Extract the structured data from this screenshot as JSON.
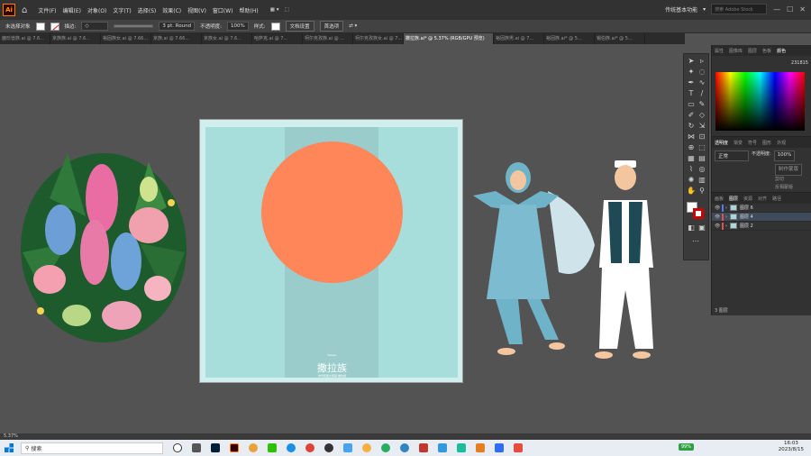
{
  "app": {
    "logo": "Ai",
    "workspace": "传统基本功能",
    "search_placeholder": "搜索 Adobe Stock"
  },
  "menu": [
    "文件(F)",
    "编辑(E)",
    "对象(O)",
    "文字(T)",
    "选择(S)",
    "效果(C)",
    "视图(V)",
    "窗口(W)",
    "帮助(H)"
  ],
  "controlbar": {
    "selection": "未选择对象",
    "stroke_label": "描边:",
    "brush": "3 pt. Round",
    "opacity_label": "不透明度:",
    "opacity": "100%",
    "style_label": "样式:",
    "doc_setup": "文档设置",
    "prefs": "首选项"
  },
  "tabs": [
    "鹿珍兽族.ai @ 7.6...",
    "京族族.ai @ 7.6...",
    "裕固族女.ai @ 7.66...",
    "京族.ai @ 7.66...",
    "京族女.ai @ 7.6...",
    "哈萨克.ai @ 7...",
    "柯尔克孜族.ai @ ...",
    "柯尔克孜族女.ai @ 7...",
    "撒拉族.ai* @ 5.37% (RGB/GPU 预览)",
    "裕固族男.ai @ 7...",
    "裕固族.ai* @ 5...",
    "锡伯族.ai* @ 5..."
  ],
  "color_panel": {
    "tabs": [
      "属性",
      "图像库",
      "图层",
      "色板",
      "颜色"
    ],
    "hex": "231815"
  },
  "transparency_panel": {
    "tabs": [
      "透明度",
      "渐变",
      "符号",
      "图形",
      "外观"
    ],
    "mode": "正常",
    "opacity_label": "不透明度:",
    "opacity": "100%",
    "btn_make_mask": "制作蒙版",
    "chk_clip": "剪切",
    "chk_invert": "反相蒙版"
  },
  "layers_panel": {
    "tabs": [
      "画板",
      "图层",
      "资源",
      "对齐",
      "路径"
    ],
    "layers": [
      {
        "name": "图层 6",
        "color": "#4a7cff"
      },
      {
        "name": "图层 4",
        "color": "#e05050",
        "selected": true
      },
      {
        "name": "图层 2",
        "color": "#e05050"
      }
    ],
    "count": "3 图层"
  },
  "artboard": {
    "title": "撒拉族",
    "small": "Salazu",
    "subtitle": "中华民族大家庭·撒拉族",
    "sun_color": "#ff8659",
    "bg_color": "#a7dedc"
  },
  "status": {
    "zoom": "5.37%"
  },
  "taskbar": {
    "search": "搜索",
    "battery": "99%",
    "time": "16:03",
    "date": "2023/8/15"
  }
}
